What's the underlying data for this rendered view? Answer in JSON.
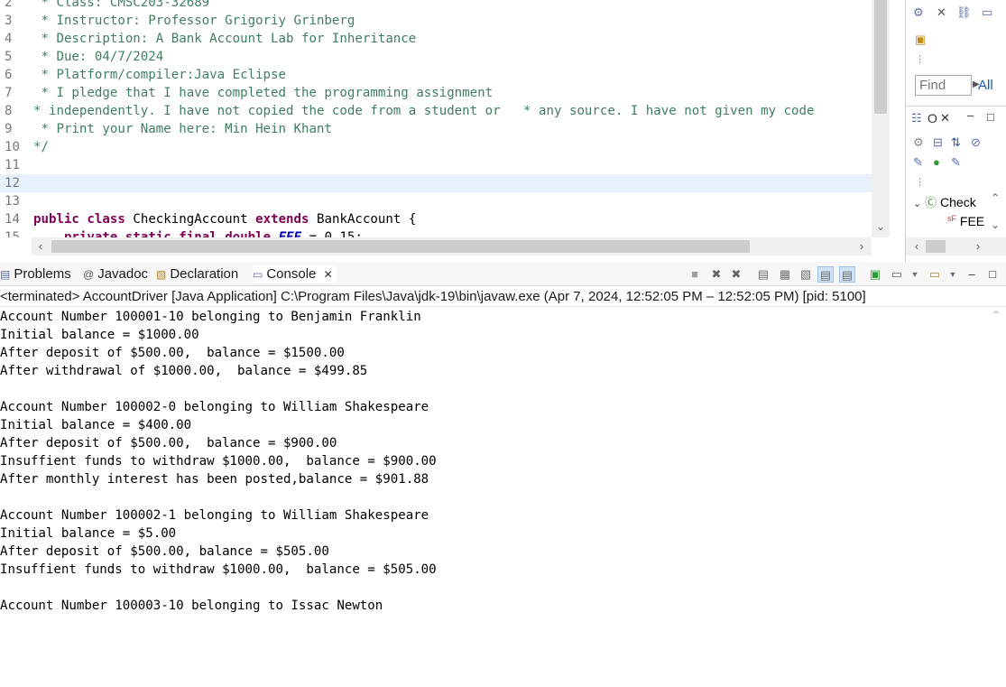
{
  "editor": {
    "lines": [
      {
        "num": "2",
        "segments": [
          {
            "cls": "cmt",
            "text": " * Class: CMSC203-32689"
          }
        ]
      },
      {
        "num": "3",
        "segments": [
          {
            "cls": "cmt",
            "text": " * Instructor: Professor Grigoriy Grinberg"
          }
        ]
      },
      {
        "num": "4",
        "segments": [
          {
            "cls": "cmt",
            "text": " * Description: A Bank Account Lab for Inheritance"
          }
        ]
      },
      {
        "num": "5",
        "segments": [
          {
            "cls": "cmt",
            "text": " * Due: 04/7/2024"
          }
        ]
      },
      {
        "num": "6",
        "segments": [
          {
            "cls": "cmt",
            "text": " * Platform/compiler:Java Eclipse"
          }
        ]
      },
      {
        "num": "7",
        "segments": [
          {
            "cls": "cmt",
            "text": " * I pledge that I have completed the programming assignment"
          }
        ]
      },
      {
        "num": "8",
        "segments": [
          {
            "cls": "cmt",
            "text": "* independently. I have not copied the code from a student or   * any source. I have not given my code"
          }
        ]
      },
      {
        "num": "9",
        "segments": [
          {
            "cls": "cmt",
            "text": " * Print your Name here: Min Hein Khant"
          }
        ]
      },
      {
        "num": "10",
        "segments": [
          {
            "cls": "cmt",
            "text": "*/"
          }
        ]
      },
      {
        "num": "11",
        "segments": []
      },
      {
        "num": "12",
        "segments": [],
        "current": true
      },
      {
        "num": "13",
        "segments": []
      },
      {
        "num": "14",
        "segments": [
          {
            "cls": "kw",
            "text": "public"
          },
          {
            "cls": "plain",
            "text": " "
          },
          {
            "cls": "kw",
            "text": "class"
          },
          {
            "cls": "plain",
            "text": " CheckingAccount "
          },
          {
            "cls": "kw",
            "text": "extends"
          },
          {
            "cls": "plain",
            "text": " BankAccount {"
          }
        ]
      },
      {
        "num": "15",
        "segments": [
          {
            "cls": "plain",
            "text": "    "
          },
          {
            "cls": "kw",
            "text": "private"
          },
          {
            "cls": "plain",
            "text": " "
          },
          {
            "cls": "kw",
            "text": "static"
          },
          {
            "cls": "plain",
            "text": " "
          },
          {
            "cls": "kw",
            "text": "final"
          },
          {
            "cls": "plain",
            "text": " "
          },
          {
            "cls": "kw",
            "text": "double"
          },
          {
            "cls": "plain",
            "text": " "
          },
          {
            "cls": "warn-field",
            "text": "FEE"
          },
          {
            "cls": "plain",
            "text": " = 0.15;"
          }
        ]
      }
    ]
  },
  "right_panel": {
    "find_placeholder": "Find",
    "all_label": "All",
    "outline_tree": [
      {
        "label": "Check",
        "icon": "class-icon"
      },
      {
        "label": "FEE",
        "icon": "static-final-field-icon"
      }
    ]
  },
  "console_tabs": [
    {
      "label": "Problems",
      "icon": "problems-icon",
      "active": false
    },
    {
      "label": "Javadoc",
      "icon": "javadoc-icon",
      "active": false
    },
    {
      "label": "Declaration",
      "icon": "declaration-icon",
      "active": false
    },
    {
      "label": "Console",
      "icon": "console-icon",
      "active": true
    }
  ],
  "console": {
    "status": "<terminated> AccountDriver [Java Application] C:\\Program Files\\Java\\jdk-19\\bin\\javaw.exe  (Apr 7, 2024, 12:52:05 PM – 12:52:05 PM) [pid: 5100]",
    "output": [
      "Account Number 100001-10 belonging to Benjamin Franklin",
      "Initial balance = $1000.00",
      "After deposit of $500.00,  balance = $1500.00",
      "After withdrawal of $1000.00,  balance = $499.85",
      "",
      "Account Number 100002-0 belonging to William Shakespeare",
      "Initial balance = $400.00",
      "After deposit of $500.00,  balance = $900.00",
      "Insuffient funds to withdraw $1000.00,  balance = $900.00",
      "After monthly interest has been posted,balance = $901.88",
      "",
      "Account Number 100002-1 belonging to William Shakespeare",
      "Initial balance = $5.00",
      "After deposit of $500.00, balance = $505.00",
      "Insuffient funds to withdraw $1000.00,  balance = $505.00",
      "",
      "Account Number 100003-10 belonging to Issac Newton"
    ]
  },
  "colors": {
    "comment": "#3f7f5f",
    "keyword": "#7f0055",
    "static_field": "#0000c0",
    "current_line": "#e8f2fe"
  }
}
